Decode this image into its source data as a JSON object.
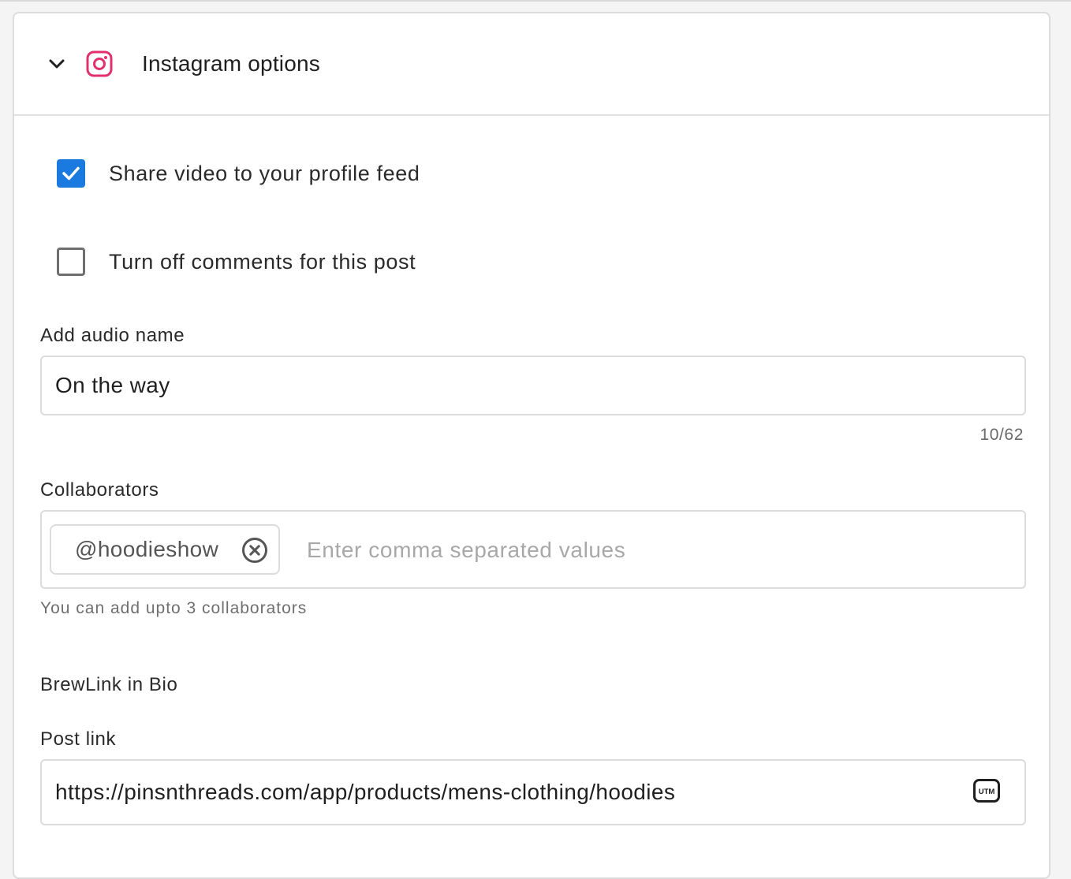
{
  "header": {
    "title": "Instagram options",
    "chevron_icon": "chevron-down-icon",
    "platform_icon": "instagram-icon",
    "platform_color": "#e1306c"
  },
  "options": {
    "share_to_feed": {
      "label": "Share video to your profile feed",
      "checked": true
    },
    "turn_off_comments": {
      "label": "Turn off comments for this post",
      "checked": false
    },
    "checkbox_color": "#1a7ae0"
  },
  "audio": {
    "label": "Add audio name",
    "value": "On the way",
    "counter": "10/62"
  },
  "collaborators": {
    "label": "Collaborators",
    "chips": [
      "@hoodieshow"
    ],
    "placeholder": "Enter comma separated values",
    "helper": "You can add upto 3 collaborators"
  },
  "bio_link": {
    "section_title": "BrewLink in Bio",
    "post_link_label": "Post link",
    "post_link_value": "https://pinsnthreads.com/app/products/mens-clothing/hoodies",
    "utm_icon": "utm-icon",
    "utm_text": "UTM"
  }
}
